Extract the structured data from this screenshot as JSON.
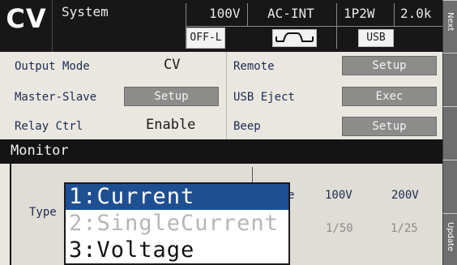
{
  "header": {
    "mode": "CV",
    "menu": "System",
    "voltage_range": "100V",
    "source": "AC-INT",
    "phase": "1P2W",
    "current_range": "2.0k",
    "output_state": "OFF-L",
    "interface": "USB",
    "waveform_icon": "sine-wave-icon"
  },
  "side_tabs": {
    "next": "Next",
    "update": "Update"
  },
  "settings": {
    "output_mode_label": "Output Mode",
    "output_mode_value": "CV",
    "master_slave_label": "Master-Slave",
    "master_slave_button": "Setup",
    "relay_label": "Relay Ctrl",
    "relay_value": "Enable",
    "remote_label": "Remote",
    "remote_button": "Setup",
    "usb_eject_label": "USB Eject",
    "usb_eject_button": "Exec",
    "beep_label": "Beep",
    "beep_button": "Setup"
  },
  "monitor": {
    "title": "Monitor",
    "type_label": "Type",
    "range_fragment": "e",
    "col1_head": "100V",
    "col2_head": "200V",
    "col1_ratio": "1/50",
    "col2_ratio": "1/25"
  },
  "dropdown": {
    "options": [
      "1:Current",
      "2:SingleCurrent",
      "3:Voltage"
    ],
    "selected_index": 0
  },
  "colors": {
    "header_bg": "#171717",
    "panel_bg": "#e9e7e0",
    "button_bg": "#8c8c8a",
    "selection": "#1f4f93",
    "label_text": "#1e2b52"
  }
}
